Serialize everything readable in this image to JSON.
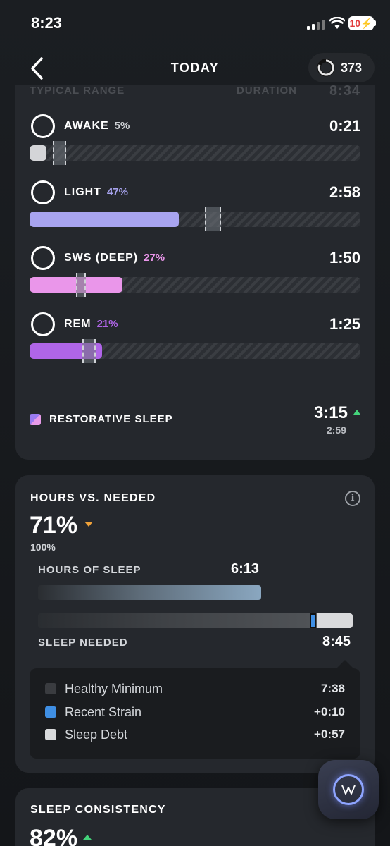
{
  "status_bar": {
    "time": "8:23",
    "battery": "10"
  },
  "nav": {
    "title": "TODAY",
    "score": "373"
  },
  "stages_header": {
    "left": "TYPICAL RANGE",
    "right": "DURATION",
    "duration": "8:34"
  },
  "stages": [
    {
      "name": "AWAKE",
      "pct": "5%",
      "duration": "0:21",
      "fill_fraction": 0.05,
      "range": [
        0.07,
        0.11
      ],
      "color": "#d4d5d8",
      "pct_color": "#cfd2d6"
    },
    {
      "name": "LIGHT",
      "pct": "47%",
      "duration": "2:58",
      "fill_fraction": 0.45,
      "range": [
        0.53,
        0.58
      ],
      "color": "#a8a4ef",
      "pct_color": "#a8a4ef"
    },
    {
      "name": "SWS (DEEP)",
      "pct": "27%",
      "duration": "1:50",
      "fill_fraction": 0.28,
      "range": [
        0.14,
        0.17
      ],
      "color": "#ea96ea",
      "pct_color": "#ea96ea"
    },
    {
      "name": "REM",
      "pct": "21%",
      "duration": "1:25",
      "fill_fraction": 0.22,
      "range": [
        0.16,
        0.2
      ],
      "color": "#b065e8",
      "pct_color": "#b065e8"
    }
  ],
  "restorative": {
    "label": "RESTORATIVE SLEEP",
    "value": "3:15",
    "previous": "2:59"
  },
  "hours_vs_needed": {
    "title": "HOURS VS. NEEDED",
    "percent": "71%",
    "baseline": "100%",
    "hours_label": "HOURS OF SLEEP",
    "hours_value": "6:13",
    "hours_fraction": 0.71,
    "needed_label": "SLEEP NEEDED",
    "needed_value": "8:45",
    "strain_fraction": [
      0.864,
      0.885
    ],
    "debt_fraction": 0.115,
    "legend": [
      {
        "label": "Healthy Minimum",
        "value": "7:38",
        "color": "#3a3c40"
      },
      {
        "label": "Recent Strain",
        "value": "+0:10",
        "color": "#3f8fe4"
      },
      {
        "label": "Sleep Debt",
        "value": "+0:57",
        "color": "#d9dadc"
      }
    ]
  },
  "consistency": {
    "title": "SLEEP CONSISTENCY",
    "percent": "82%"
  }
}
